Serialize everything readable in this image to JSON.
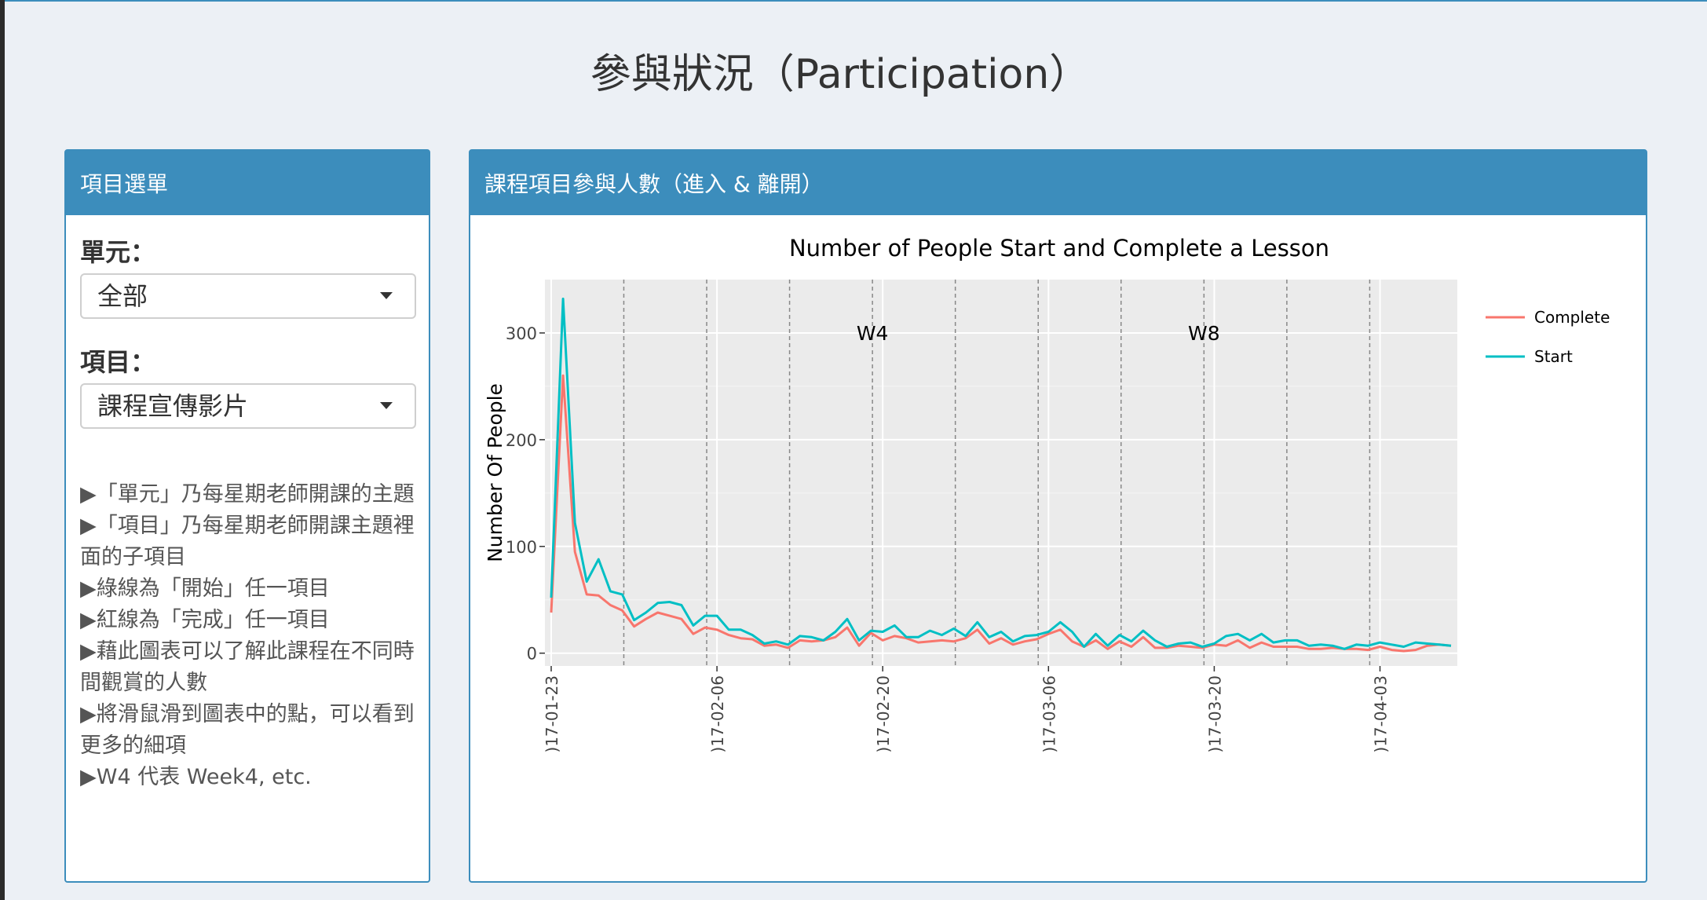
{
  "page": {
    "title": "參與狀況（Participation）"
  },
  "sidebar": {
    "header": "項目選單",
    "unit_label": "單元：",
    "unit_value": "全部",
    "item_label": "項目：",
    "item_value": "課程宣傳影片",
    "notes": [
      "▶「單元」乃每星期老師開課的主題",
      "▶「項目」乃每星期老師開課主題裡面的子項目",
      "▶綠線為「開始」任一項目",
      "▶紅線為「完成」任一項目",
      "▶藉此圖表可以了解此課程在不同時間觀賞的人數",
      "▶將滑鼠滑到圖表中的點，可以看到更多的細項",
      "▶W4 代表 Week4, etc."
    ]
  },
  "chart_panel": {
    "header": "課程項目參與人數（進入 & 離開）"
  },
  "colors": {
    "accent": "#3c8dbc",
    "complete": "#f8766d",
    "start": "#00bfc4",
    "plot_bg": "#ebebeb"
  },
  "chart_data": {
    "type": "line",
    "title": "Number of People Start and Complete a Lesson",
    "xlabel": "",
    "ylabel": "Number Of People",
    "x_start": "2017-01-23",
    "x_end": "2017-04-09",
    "ylim": [
      -12,
      350
    ],
    "yticks": [
      0,
      100,
      200,
      300
    ],
    "xticks": [
      {
        "date": "2017-01-23",
        "label": ")17-01-23"
      },
      {
        "date": "2017-02-06",
        "label": ")17-02-06"
      },
      {
        "date": "2017-02-20",
        "label": ")17-02-20"
      },
      {
        "date": "2017-03-06",
        "label": ")17-03-06"
      },
      {
        "date": "2017-03-20",
        "label": ")17-03-20"
      },
      {
        "date": "2017-04-03",
        "label": ")17-04-03"
      }
    ],
    "week_lines": [
      "2017-01-29",
      "2017-02-05",
      "2017-02-12",
      "2017-02-19",
      "2017-02-26",
      "2017-03-05",
      "2017-03-12",
      "2017-03-19",
      "2017-03-26",
      "2017-04-02"
    ],
    "annotations": [
      {
        "text": "W4",
        "date": "2017-02-19",
        "y": 300
      },
      {
        "text": "W8",
        "date": "2017-03-19",
        "y": 300
      }
    ],
    "legend_position": "right",
    "series": [
      {
        "name": "Complete",
        "color": "#f8766d",
        "points": [
          [
            "2017-01-23",
            38
          ],
          [
            "2017-01-24",
            260
          ],
          [
            "2017-01-25",
            95
          ],
          [
            "2017-01-26",
            55
          ],
          [
            "2017-01-27",
            54
          ],
          [
            "2017-01-28",
            45
          ],
          [
            "2017-01-29",
            40
          ],
          [
            "2017-01-30",
            25
          ],
          [
            "2017-01-31",
            32
          ],
          [
            "2017-02-01",
            38
          ],
          [
            "2017-02-02",
            35
          ],
          [
            "2017-02-03",
            32
          ],
          [
            "2017-02-04",
            18
          ],
          [
            "2017-02-05",
            24
          ],
          [
            "2017-02-06",
            22
          ],
          [
            "2017-02-07",
            17
          ],
          [
            "2017-02-08",
            14
          ],
          [
            "2017-02-09",
            13
          ],
          [
            "2017-02-10",
            7
          ],
          [
            "2017-02-11",
            8
          ],
          [
            "2017-02-12",
            5
          ],
          [
            "2017-02-13",
            12
          ],
          [
            "2017-02-14",
            11
          ],
          [
            "2017-02-15",
            12
          ],
          [
            "2017-02-16",
            15
          ],
          [
            "2017-02-17",
            24
          ],
          [
            "2017-02-18",
            7
          ],
          [
            "2017-02-19",
            19
          ],
          [
            "2017-02-20",
            12
          ],
          [
            "2017-02-21",
            16
          ],
          [
            "2017-02-22",
            14
          ],
          [
            "2017-02-23",
            10
          ],
          [
            "2017-02-24",
            11
          ],
          [
            "2017-02-25",
            12
          ],
          [
            "2017-02-26",
            11
          ],
          [
            "2017-02-27",
            14
          ],
          [
            "2017-02-28",
            22
          ],
          [
            "2017-03-01",
            9
          ],
          [
            "2017-03-02",
            14
          ],
          [
            "2017-03-03",
            8
          ],
          [
            "2017-03-04",
            11
          ],
          [
            "2017-03-05",
            13
          ],
          [
            "2017-03-06",
            18
          ],
          [
            "2017-03-07",
            22
          ],
          [
            "2017-03-08",
            11
          ],
          [
            "2017-03-09",
            6
          ],
          [
            "2017-03-10",
            12
          ],
          [
            "2017-03-11",
            4
          ],
          [
            "2017-03-12",
            11
          ],
          [
            "2017-03-13",
            6
          ],
          [
            "2017-03-14",
            15
          ],
          [
            "2017-03-15",
            5
          ],
          [
            "2017-03-16",
            5
          ],
          [
            "2017-03-17",
            7
          ],
          [
            "2017-03-18",
            6
          ],
          [
            "2017-03-19",
            5
          ],
          [
            "2017-03-20",
            8
          ],
          [
            "2017-03-21",
            7
          ],
          [
            "2017-03-22",
            12
          ],
          [
            "2017-03-23",
            5
          ],
          [
            "2017-03-24",
            10
          ],
          [
            "2017-03-25",
            6
          ],
          [
            "2017-03-26",
            6
          ],
          [
            "2017-03-27",
            6
          ],
          [
            "2017-03-28",
            4
          ],
          [
            "2017-03-29",
            4
          ],
          [
            "2017-03-30",
            5
          ],
          [
            "2017-03-31",
            4
          ],
          [
            "2017-04-01",
            4
          ],
          [
            "2017-04-02",
            3
          ],
          [
            "2017-04-03",
            6
          ],
          [
            "2017-04-04",
            3
          ],
          [
            "2017-04-05",
            2
          ],
          [
            "2017-04-06",
            3
          ],
          [
            "2017-04-07",
            7
          ],
          [
            "2017-04-08",
            8
          ],
          [
            "2017-04-09",
            7
          ]
        ]
      },
      {
        "name": "Start",
        "color": "#00bfc4",
        "points": [
          [
            "2017-01-23",
            52
          ],
          [
            "2017-01-24",
            332
          ],
          [
            "2017-01-25",
            122
          ],
          [
            "2017-01-26",
            67
          ],
          [
            "2017-01-27",
            88
          ],
          [
            "2017-01-28",
            58
          ],
          [
            "2017-01-29",
            55
          ],
          [
            "2017-01-30",
            31
          ],
          [
            "2017-01-31",
            38
          ],
          [
            "2017-02-01",
            47
          ],
          [
            "2017-02-02",
            48
          ],
          [
            "2017-02-03",
            45
          ],
          [
            "2017-02-04",
            26
          ],
          [
            "2017-02-05",
            35
          ],
          [
            "2017-02-06",
            35
          ],
          [
            "2017-02-07",
            22
          ],
          [
            "2017-02-08",
            22
          ],
          [
            "2017-02-09",
            17
          ],
          [
            "2017-02-10",
            9
          ],
          [
            "2017-02-11",
            11
          ],
          [
            "2017-02-12",
            8
          ],
          [
            "2017-02-13",
            16
          ],
          [
            "2017-02-14",
            15
          ],
          [
            "2017-02-15",
            12
          ],
          [
            "2017-02-16",
            20
          ],
          [
            "2017-02-17",
            32
          ],
          [
            "2017-02-18",
            12
          ],
          [
            "2017-02-19",
            21
          ],
          [
            "2017-02-20",
            20
          ],
          [
            "2017-02-21",
            26
          ],
          [
            "2017-02-22",
            15
          ],
          [
            "2017-02-23",
            15
          ],
          [
            "2017-02-24",
            21
          ],
          [
            "2017-02-25",
            17
          ],
          [
            "2017-02-26",
            23
          ],
          [
            "2017-02-27",
            16
          ],
          [
            "2017-02-28",
            29
          ],
          [
            "2017-03-01",
            15
          ],
          [
            "2017-03-02",
            20
          ],
          [
            "2017-03-03",
            11
          ],
          [
            "2017-03-04",
            16
          ],
          [
            "2017-03-05",
            17
          ],
          [
            "2017-03-06",
            20
          ],
          [
            "2017-03-07",
            29
          ],
          [
            "2017-03-08",
            20
          ],
          [
            "2017-03-09",
            6
          ],
          [
            "2017-03-10",
            18
          ],
          [
            "2017-03-11",
            7
          ],
          [
            "2017-03-12",
            17
          ],
          [
            "2017-03-13",
            11
          ],
          [
            "2017-03-14",
            21
          ],
          [
            "2017-03-15",
            12
          ],
          [
            "2017-03-16",
            6
          ],
          [
            "2017-03-17",
            9
          ],
          [
            "2017-03-18",
            10
          ],
          [
            "2017-03-19",
            6
          ],
          [
            "2017-03-20",
            9
          ],
          [
            "2017-03-21",
            16
          ],
          [
            "2017-03-22",
            18
          ],
          [
            "2017-03-23",
            12
          ],
          [
            "2017-03-24",
            18
          ],
          [
            "2017-03-25",
            10
          ],
          [
            "2017-03-26",
            12
          ],
          [
            "2017-03-27",
            12
          ],
          [
            "2017-03-28",
            7
          ],
          [
            "2017-03-29",
            8
          ],
          [
            "2017-03-30",
            7
          ],
          [
            "2017-03-31",
            4
          ],
          [
            "2017-04-01",
            8
          ],
          [
            "2017-04-02",
            7
          ],
          [
            "2017-04-03",
            10
          ],
          [
            "2017-04-04",
            8
          ],
          [
            "2017-04-05",
            6
          ],
          [
            "2017-04-06",
            10
          ],
          [
            "2017-04-07",
            9
          ],
          [
            "2017-04-08",
            8
          ],
          [
            "2017-04-09",
            7
          ]
        ]
      }
    ]
  }
}
